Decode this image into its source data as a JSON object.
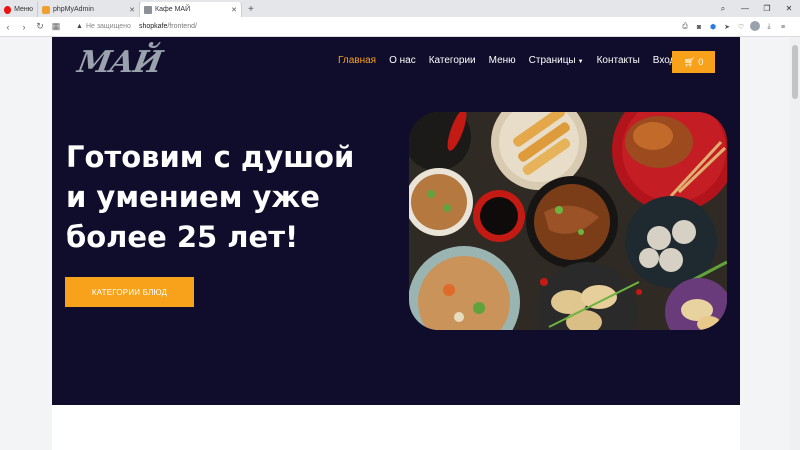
{
  "browser": {
    "tabs": [
      {
        "label": "Меню",
        "active": false
      },
      {
        "label": "phpMyAdmin",
        "active": false
      },
      {
        "label": "Кафе МАЙ",
        "active": true
      }
    ],
    "new_tab": "+",
    "security_label": "Не защищено",
    "url_host": "shopkafe",
    "url_path": "/frontend/"
  },
  "site": {
    "logo": "МАЙ",
    "nav": [
      {
        "label": "Главная",
        "active": true
      },
      {
        "label": "О нас",
        "active": false
      },
      {
        "label": "Категории",
        "active": false
      },
      {
        "label": "Меню",
        "active": false
      },
      {
        "label": "Страницы",
        "active": false,
        "dropdown": true
      },
      {
        "label": "Контакты",
        "active": false
      },
      {
        "label": "Вход",
        "active": false
      }
    ],
    "cart_count": "0",
    "headline_lines": [
      "Готовим с душой",
      "и умением уже",
      "более 25 лет!"
    ],
    "cta_label": "КАТЕГОРИИ БЛЮД"
  },
  "colors": {
    "accent": "#f7a21a",
    "hero_bg": "#0f0d2b"
  },
  "icons": [
    "back-icon",
    "forward-icon",
    "reload-icon",
    "tabs-grid-icon",
    "warning-icon",
    "search-icon",
    "camera-icon",
    "shield-icon",
    "send-icon",
    "heart-icon",
    "profile-icon",
    "download-icon",
    "menu-icon",
    "cart-icon"
  ]
}
